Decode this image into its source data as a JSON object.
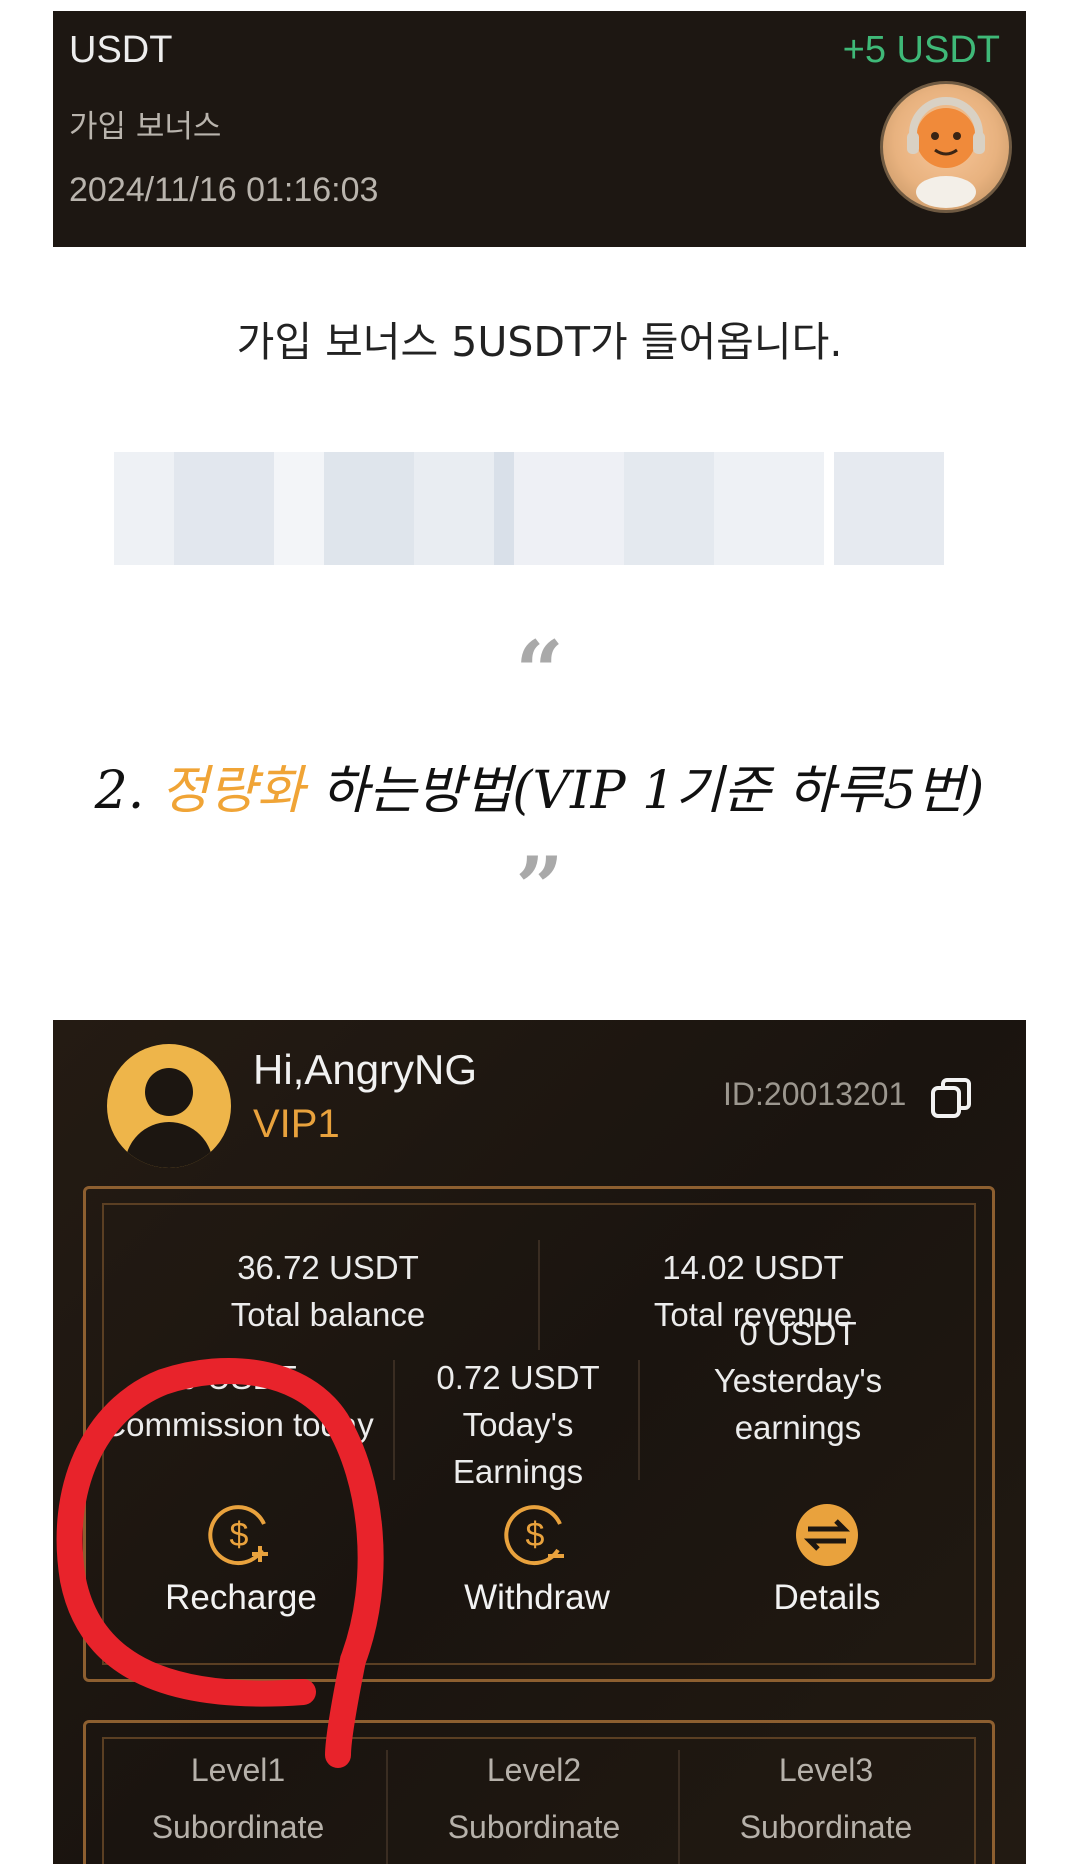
{
  "notification": {
    "title": "USDT",
    "subtitle": "가입 보너스",
    "timestamp": "2024/11/16 01:16:03",
    "amount": "+5 USDT"
  },
  "blog": {
    "caption": "가입 보너스 5USDT가 들어옵니다.",
    "open_quote": "“",
    "heading_prefix": "2. ",
    "heading_highlight": "정량화",
    "heading_rest": " 하는방법(VIP 1기준 하루5번)",
    "close_quote": "”",
    "highlight_color": "#f0a436"
  },
  "app": {
    "greeting": "Hi,AngryNG",
    "vip_level": "VIP1",
    "user_id": "ID:20013201",
    "stats": {
      "total_balance_value": "36.72 USDT",
      "total_balance_label": "Total balance",
      "total_revenue_value": "14.02 USDT",
      "total_revenue_label": "Total revenue",
      "commission_value": "0 USDT",
      "commission_label": "Commission today",
      "today_value": "0.72 USDT",
      "today_label": "Today's Earnings",
      "yesterday_value": "0 USDT",
      "yesterday_label_1": "Yesterday's",
      "yesterday_label_2": "earnings"
    },
    "actions": {
      "recharge": "Recharge",
      "withdraw": "Withdraw",
      "details": "Details"
    },
    "levels": [
      {
        "name": "Level1",
        "label": "Subordinate"
      },
      {
        "name": "Level2",
        "label": "Subordinate"
      },
      {
        "name": "Level3",
        "label": "Subordinate"
      }
    ],
    "colors": {
      "accent": "#e9a23d",
      "positive": "#3fb978",
      "annotation": "#e8232b"
    }
  }
}
